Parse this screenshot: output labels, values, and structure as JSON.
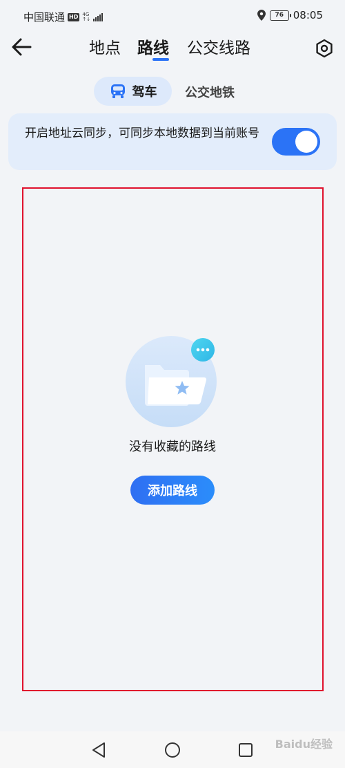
{
  "status_bar": {
    "carrier": "中国联通",
    "hd": "HD",
    "network": "4G",
    "battery": "76",
    "time": "08:05"
  },
  "header": {
    "tabs": [
      {
        "label": "地点",
        "active": false
      },
      {
        "label": "路线",
        "active": true
      },
      {
        "label": "公交线路",
        "active": false
      }
    ]
  },
  "segments": {
    "drive": "驾车",
    "transit": "公交地铁",
    "selected": "驾车"
  },
  "sync": {
    "text": "开启地址云同步，可同步本地数据到当前账号",
    "enabled": true
  },
  "empty_state": {
    "message": "没有收藏的路线",
    "add_button": "添加路线"
  },
  "watermark": "Baidu经验",
  "colors": {
    "accent": "#2b73f6",
    "highlight_frame": "#e0112d",
    "background": "#f2f4f7"
  }
}
